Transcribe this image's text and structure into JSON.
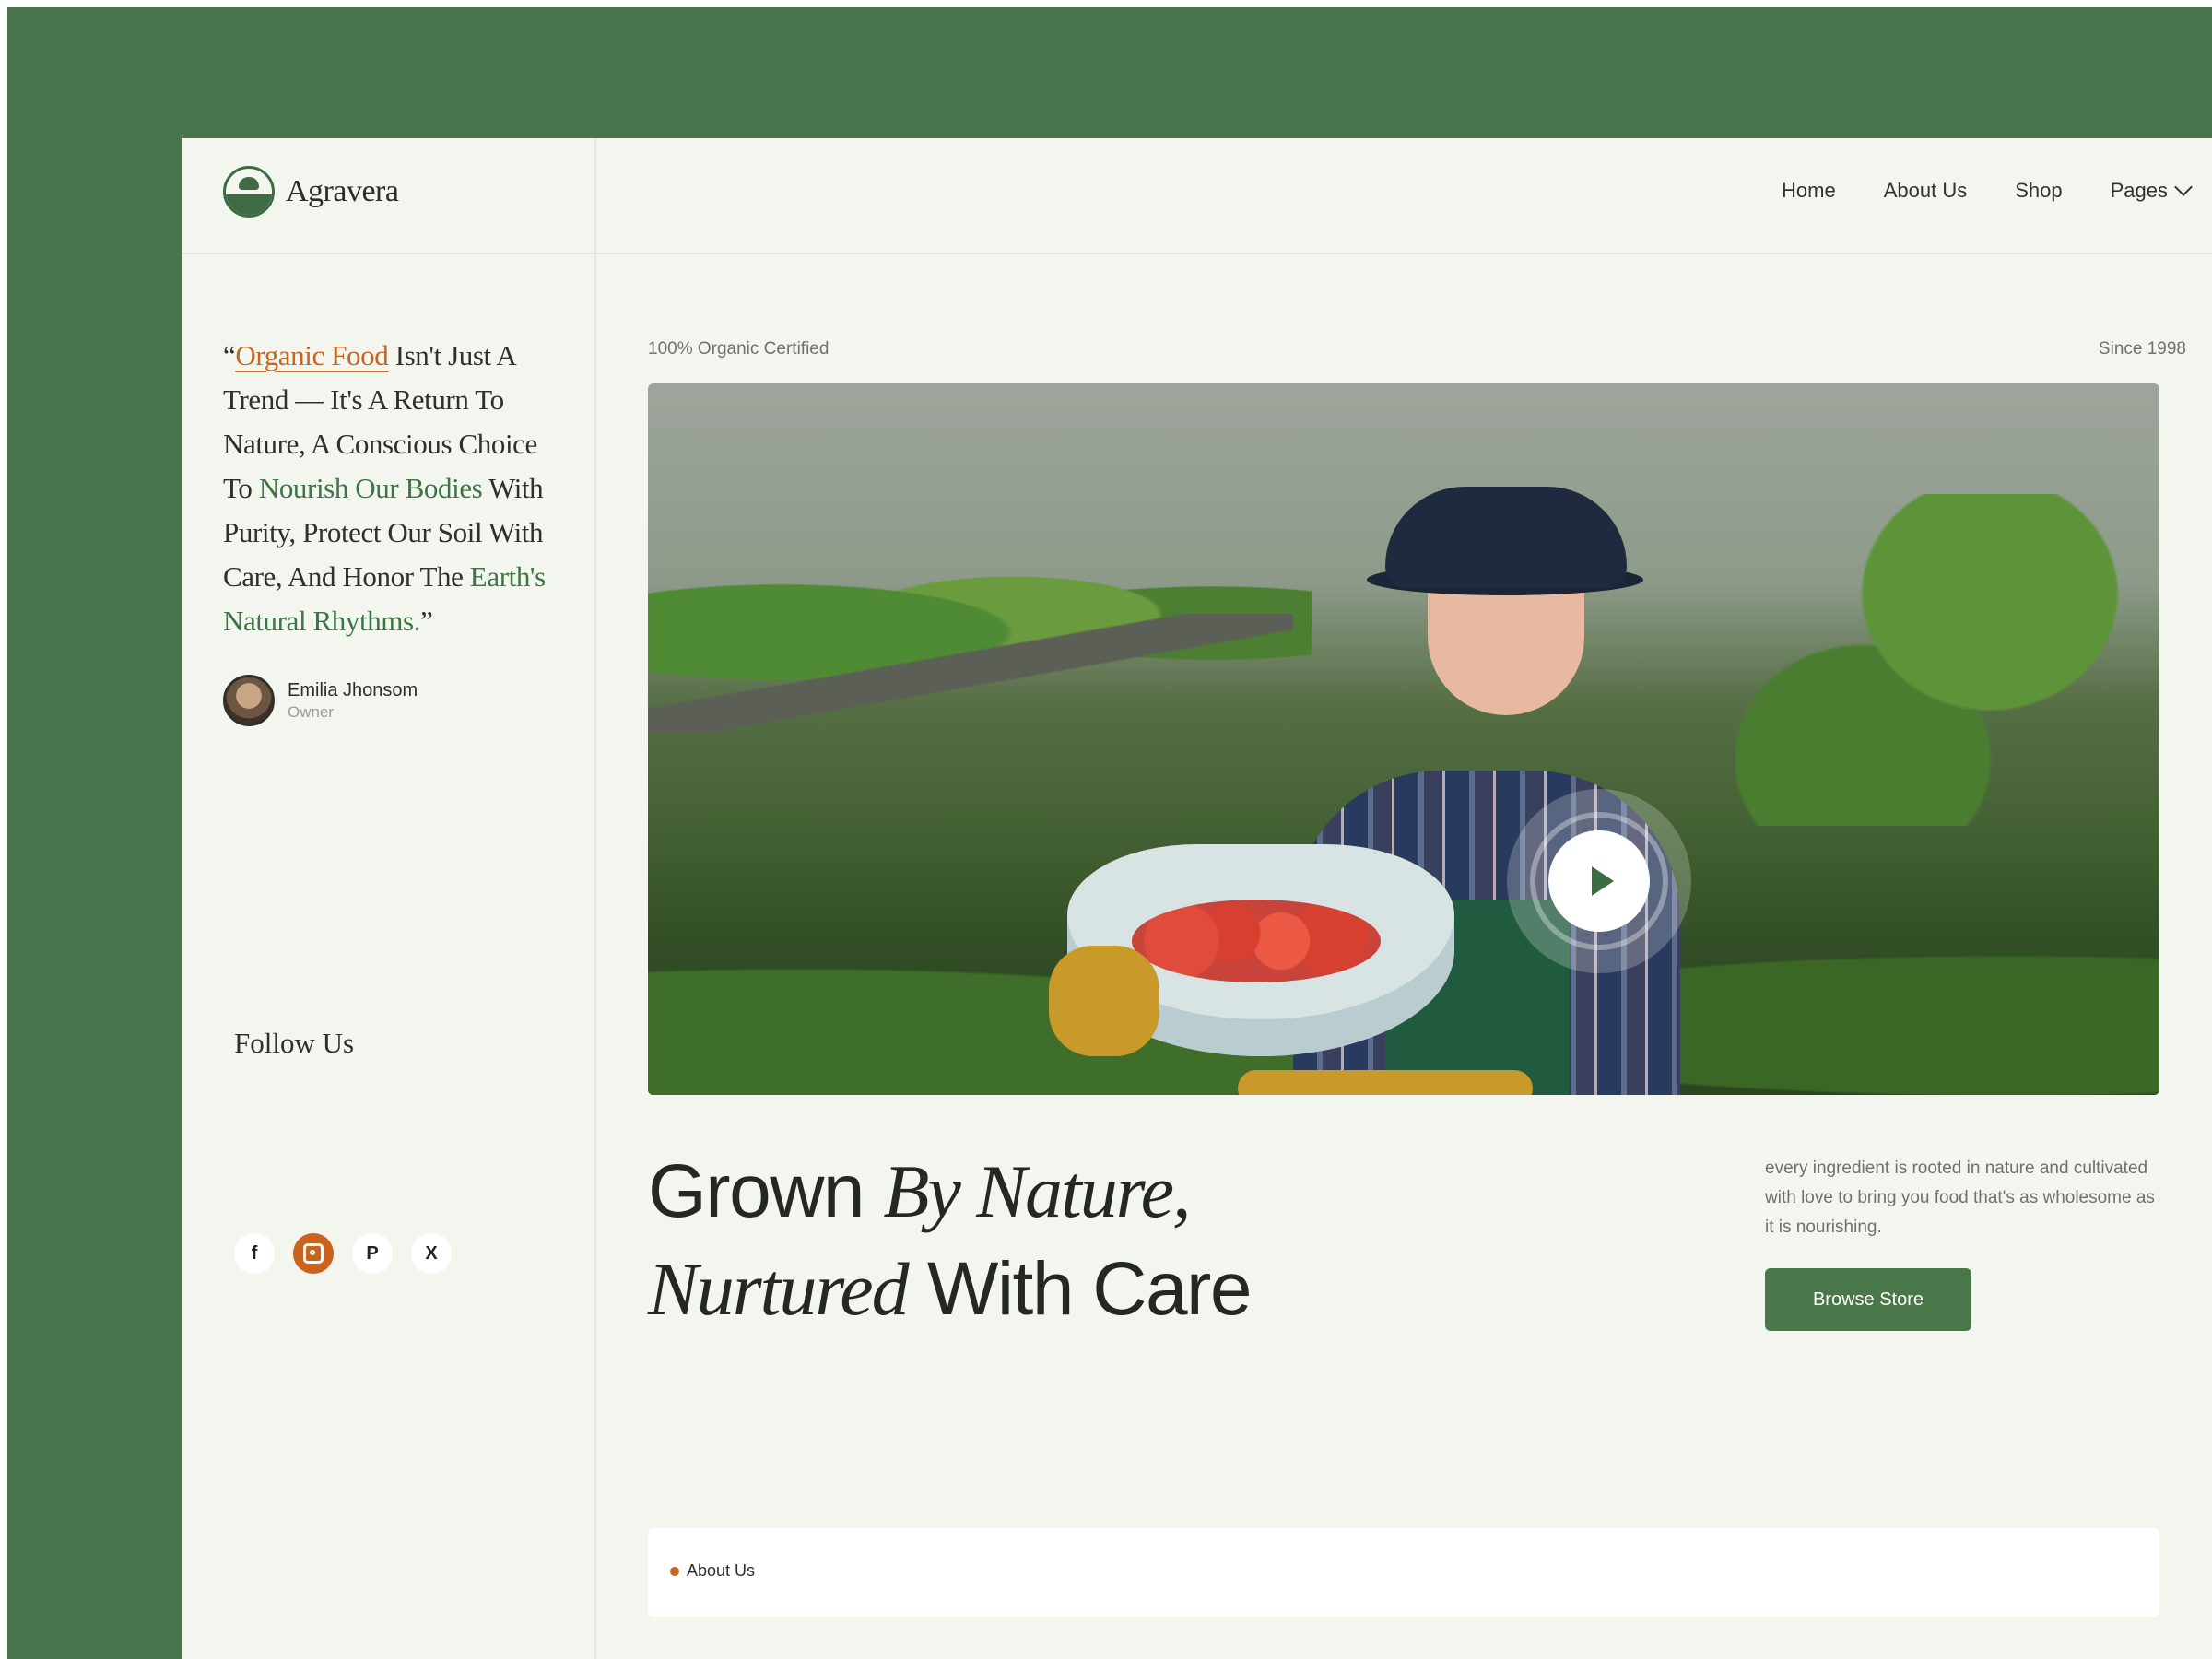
{
  "brand": {
    "name": "Agravera"
  },
  "nav": {
    "home": "Home",
    "about": "About Us",
    "shop": "Shop",
    "pages": "Pages"
  },
  "quote": {
    "open": "“",
    "highlight_orange": "Organic Food",
    "part1": " Isn't Just A Trend — It's A Return To Nature, A Conscious Choice To ",
    "highlight_green1": "Nourish Our Bodies",
    "part2": " With Purity, Protect Our Soil With Care, And Honor The ",
    "highlight_green2": "Earth's Natural Rhythms.",
    "close": "”"
  },
  "author": {
    "name": "Emilia Jhonsom",
    "role": "Owner"
  },
  "follow": {
    "title": "Follow Us",
    "icons": [
      "facebook-icon",
      "instagram-icon",
      "pinterest-icon",
      "x-icon"
    ],
    "facebook_glyph": "f",
    "pinterest_glyph": "P",
    "x_glyph": "X"
  },
  "hero": {
    "tag_left": "100% Organic Certified",
    "tag_right": "Since 1998",
    "headline_sans1": "Grown ",
    "headline_serif1": "By Nature,",
    "headline_serif2": "Nurtured",
    "headline_sans2": " With Care",
    "description": "every ingredient is rooted in nature and cultivated with love to bring you food that's as wholesome as it is nourishing.",
    "cta": "Browse Store"
  },
  "about_section": {
    "label": "About Us"
  },
  "colors": {
    "frame": "#49744c",
    "page_bg": "#f3f6ef",
    "accent_orange": "#c9631e",
    "accent_green": "#497749"
  }
}
